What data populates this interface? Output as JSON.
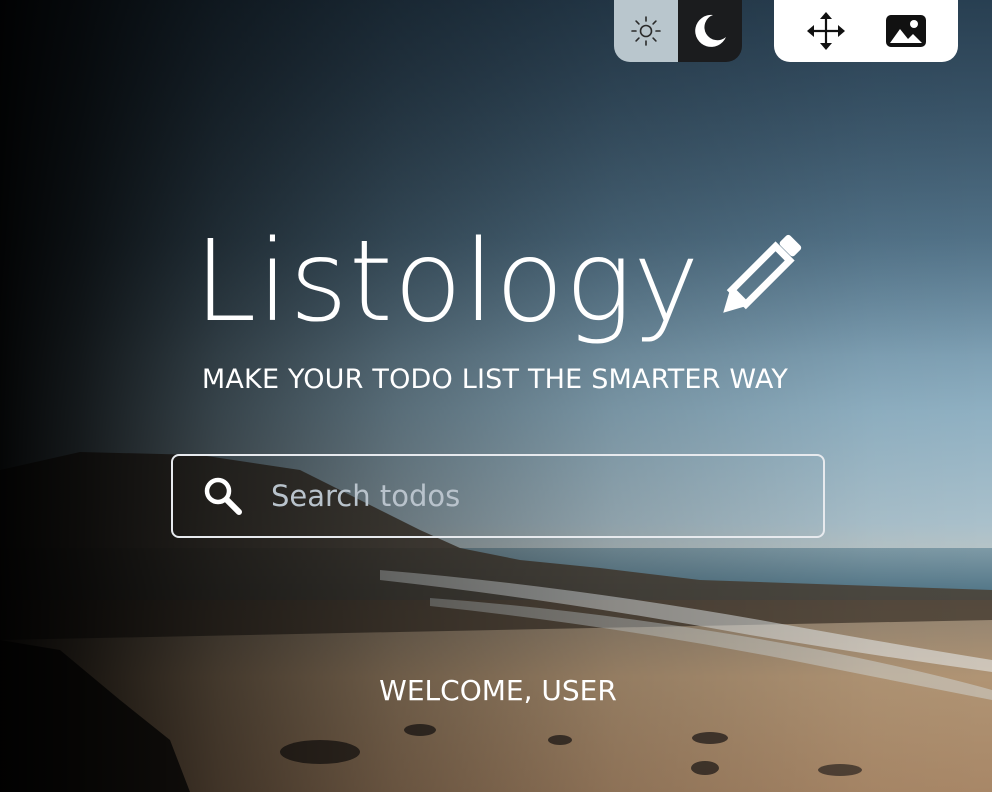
{
  "app": {
    "title": "Listology",
    "tagline": "MAKE YOUR TODO LIST THE SMARTER WAY"
  },
  "theme_toggle": {
    "light": {
      "icon": "sun-icon",
      "active": false
    },
    "dark": {
      "icon": "moon-icon",
      "active": true
    }
  },
  "toolbar": {
    "move_icon": "move-arrows-icon",
    "background_icon": "image-icon"
  },
  "search": {
    "icon": "search-icon",
    "placeholder": "Search todos",
    "value": ""
  },
  "welcome_text": "WELCOME, USER",
  "colors": {
    "light_toggle_bg": "#b9c6cd",
    "dark_toggle_bg": "#1b1c1e",
    "toolbar_bg": "#ffffff",
    "text": "#ffffff",
    "search_border": "#e7eaee",
    "placeholder": "#b9c3cc"
  }
}
